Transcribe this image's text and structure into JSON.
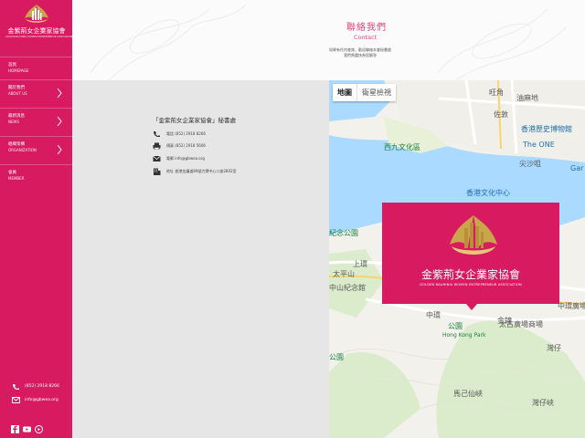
{
  "brand": {
    "name_zh": "金紫荊女企業家協會",
    "name_en": "GOLDEN BAUHINIA WOMEN ENTREPRENEUR ASSOCIATION"
  },
  "colors": {
    "primary": "#d81b60",
    "accent": "#e0457a",
    "gold": "#c9a64a"
  },
  "sidebar": {
    "items": [
      {
        "zh": "首頁",
        "en": "HOMEPAGE",
        "has_arrow": false
      },
      {
        "zh": "關於我們",
        "en": "ABOUT US",
        "has_arrow": true
      },
      {
        "zh": "最新消息",
        "en": "NEWS",
        "has_arrow": true
      },
      {
        "zh": "組織架構",
        "en": "ORGANIZATION",
        "has_arrow": true
      },
      {
        "zh": "會員",
        "en": "MEMBER",
        "has_arrow": false
      }
    ],
    "phone": "(852) 2918 8266",
    "email": "info@gbwea.org",
    "social": [
      "facebook-icon",
      "youtube-icon",
      "play-icon"
    ]
  },
  "header": {
    "title_zh": "聯絡我們",
    "title_en": "Contact",
    "intro_line1": "如果有任何查詢，歡迎聯絡本會秘書處",
    "intro_line2": "我們將盡快為您解答"
  },
  "office": {
    "title": "「金紫荊女企業家協會」秘書處",
    "phone": "電話 (852) 2918 8266",
    "fax": "傳真 (852) 2918 5606",
    "email": "電郵 info@gbwea.org",
    "address": "地址 香港金鐘道89號力寶中心二座2802室"
  },
  "map": {
    "tab_map": "地圖",
    "tab_satellite": "衛星檢視",
    "labels": {
      "l1": "旺角",
      "l2": "油麻地",
      "l3": "佐敦",
      "l4": "香港歷史博物館",
      "l5": "The ONE",
      "l6": "西九文化區",
      "l7": "尖沙咀",
      "l8": "Gar",
      "l9": "香港文化中心",
      "l10": "紀念公園",
      "l11": "上環",
      "l12": "太平山",
      "l13": "中山紀念館",
      "l14": "中環",
      "l15": "中環廣場",
      "l16": "金鐘",
      "l17": "太古廣場商場",
      "l18": "公園",
      "l19": "Hong Kong Park",
      "l20": "灣仔",
      "l21": "馬己仙峽",
      "l22": "灣仔峽",
      "l23": "公園"
    }
  }
}
